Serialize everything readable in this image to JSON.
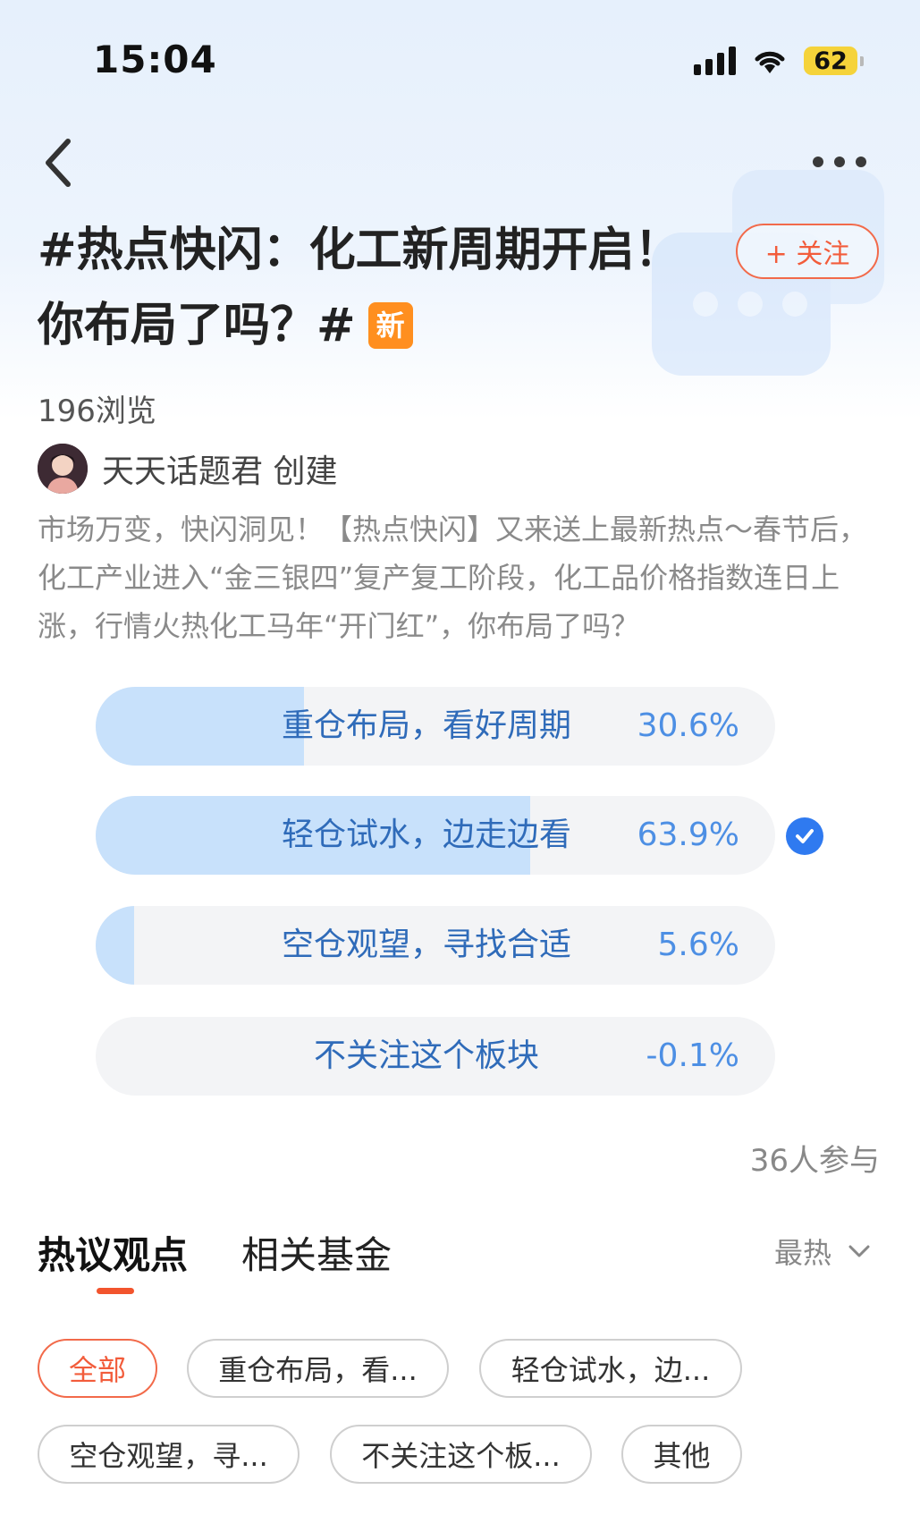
{
  "status": {
    "time": "15:04",
    "battery": "62"
  },
  "topic": {
    "title": "#热点快闪：化工新周期开启！你布局了吗？#",
    "badge": "新",
    "follow_label": "+ 关注",
    "views": "196浏览",
    "creator": "天天话题君 创建",
    "description": "市场万变，快闪洞见！【热点快闪】又来送上最新热点～春节后，化工产业进入“金三银四”复产复工阶段，化工品价格指数连日上涨，行情火热化工马年“开门红”，你布局了吗？"
  },
  "poll": {
    "options": [
      {
        "label": "重仓布局，看好周期反...",
        "percent_text": "30.6%",
        "fill": 0.306,
        "selected": false
      },
      {
        "label": "轻仓试水，边走边看",
        "percent_text": "63.9%",
        "fill": 0.639,
        "selected": true
      },
      {
        "label": "空仓观望，寻找合适买...",
        "percent_text": "5.6%",
        "fill": 0.056,
        "selected": false
      },
      {
        "label": "不关注这个板块",
        "percent_text": "-0.1%",
        "fill": 0.0,
        "selected": false
      }
    ],
    "participants": "36人参与"
  },
  "tabs": {
    "active": "热议观点",
    "second": "相关基金",
    "sort": "最热"
  },
  "filters": [
    "全部",
    "重仓布局，看...",
    "轻仓试水，边...",
    "空仓观望，寻...",
    "不关注这个板...",
    "其他"
  ],
  "colors": {
    "accent": "#f25c3b",
    "poll_fill": "#c8e1fb",
    "poll_text": "#2f6bb9",
    "check": "#2f7af0",
    "badge": "#ff8f1f"
  }
}
